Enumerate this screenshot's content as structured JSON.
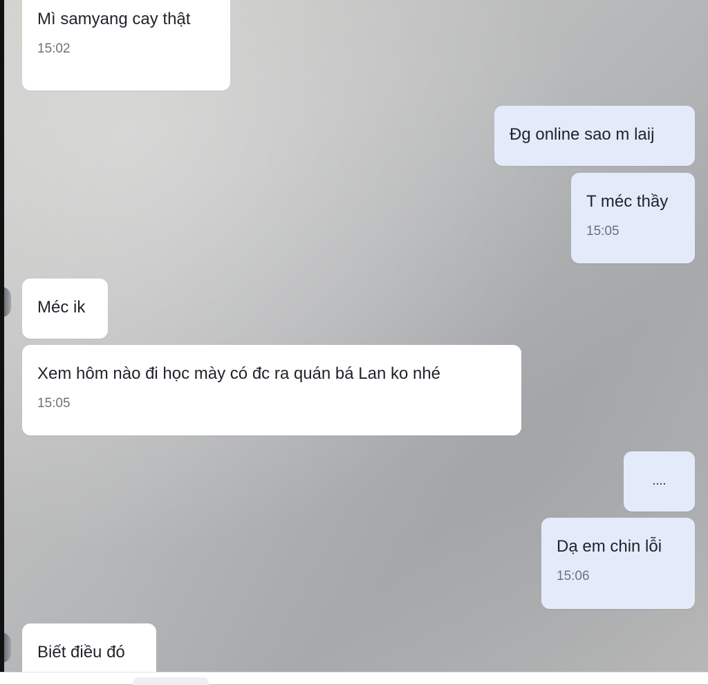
{
  "messages": [
    {
      "direction": "incoming",
      "text": "Mì samyang cay thật",
      "time": "15:02"
    },
    {
      "direction": "outgoing",
      "text": "Đg online sao m laij",
      "time": ""
    },
    {
      "direction": "outgoing",
      "text": "T méc thầy",
      "time": "15:05"
    },
    {
      "direction": "incoming",
      "text": "Méc ik",
      "time": ""
    },
    {
      "direction": "incoming",
      "text": "Xem hôm nào đi học mày có đc ra quán bá Lan ko nhé",
      "time": "15:05"
    },
    {
      "direction": "outgoing",
      "text": "....",
      "time": ""
    },
    {
      "direction": "outgoing",
      "text": "Dạ em chin lỗi",
      "time": "15:06"
    },
    {
      "direction": "incoming",
      "text": "Biết điều đó",
      "time": ""
    }
  ],
  "colors": {
    "incoming_bubble": "#ffffff",
    "outgoing_bubble": "#e3ebfb",
    "timestamp": "#6c717a"
  }
}
